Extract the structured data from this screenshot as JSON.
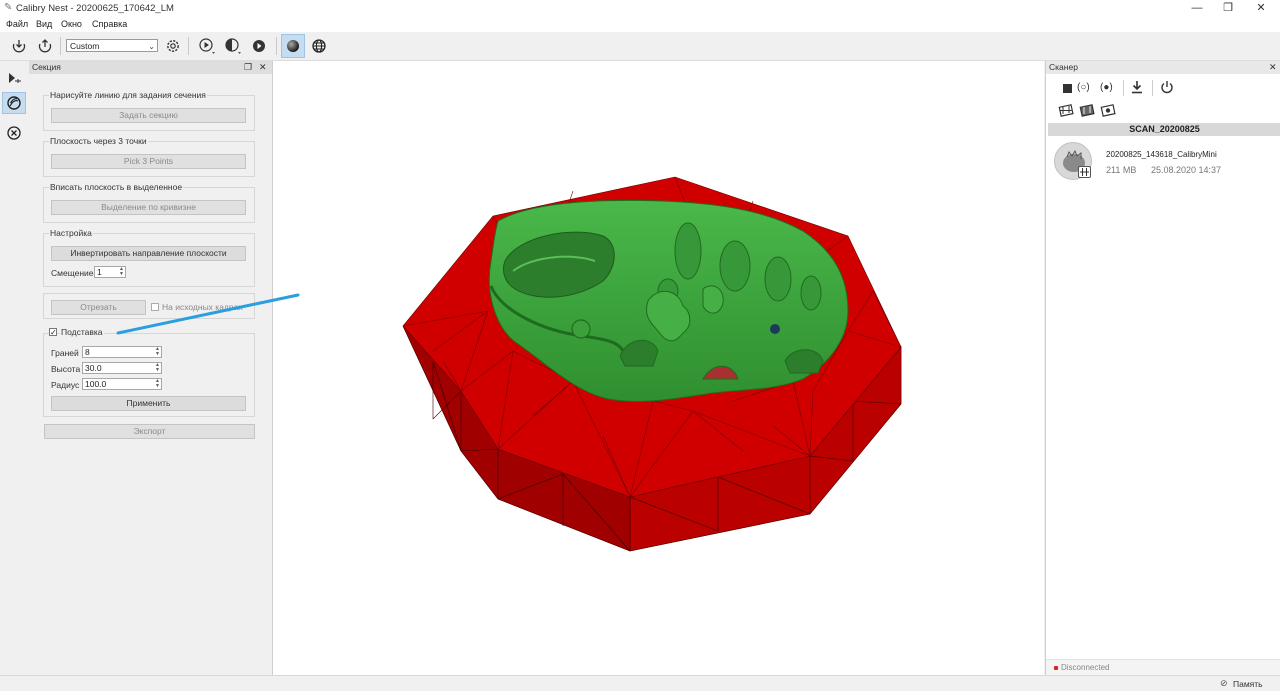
{
  "window": {
    "title": "Calibry Nest - 20200625_170642_LM"
  },
  "menu": [
    "Файл",
    "Вид",
    "Окно",
    "Справка"
  ],
  "toolbar": {
    "preset": "Custom"
  },
  "section_panel": {
    "title": "Секция",
    "draw_line": {
      "label": "Нарисуйте линию для задания сечения",
      "button": "Задать секцию"
    },
    "three_points": {
      "label": "Плоскость через 3 точки",
      "button": "Pick 3 Points"
    },
    "fit_plane": {
      "label": "Вписать плоскость в выделенное",
      "button": "Выделение по кривизне"
    },
    "settings": {
      "label": "Настройка",
      "invert_button": "Инвертировать направление плоскости",
      "offset_label": "Смещение",
      "offset_value": "1"
    },
    "cut_button": "Отрезать",
    "on_source_label": "На исходных кадрах",
    "on_source_checked": false,
    "stand": {
      "label": "Подставка",
      "checked": true,
      "faces_label": "Граней",
      "faces_value": "8",
      "height_label": "Высота",
      "height_value": "30.0",
      "radius_label": "Радиус",
      "radius_value": "100.0",
      "apply_button": "Применить"
    },
    "export_button": "Экспорт"
  },
  "scanner_panel": {
    "title": "Сканер",
    "scan_header": "SCAN_20200825",
    "scan_item": {
      "name": "20200825_143618_CalibryMini",
      "size": "211 MB",
      "date": "25.08.2020 14:37"
    }
  },
  "status": {
    "connection": "Disconnected",
    "memory": "Память",
    "connection_color": "#e02020"
  },
  "colors": {
    "model_green": "#3fa33f",
    "base_red": "#cc0000",
    "accent_blue": "#2a9fe0"
  }
}
